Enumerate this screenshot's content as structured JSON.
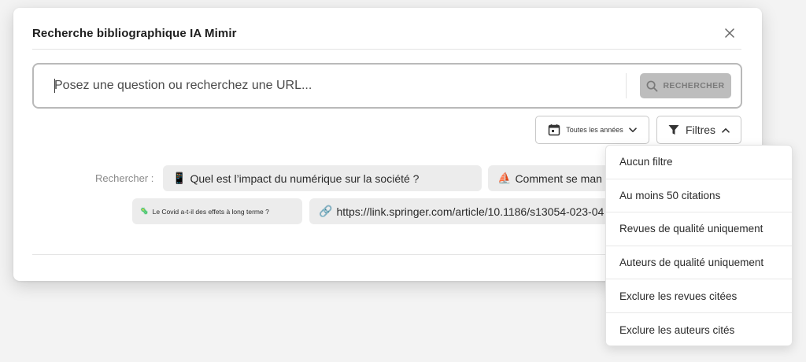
{
  "modal": {
    "title": "Recherche bibliographique IA Mimir"
  },
  "search": {
    "placeholder": "Posez une question ou recherchez une URL...",
    "button_label": "RECHERCHER"
  },
  "filters_bar": {
    "years_label": "Toutes les années",
    "filters_label": "Filtres"
  },
  "suggestions": {
    "label": "Rechercher :",
    "chips": [
      {
        "icon": "📱",
        "text": "Quel est l’impact du numérique sur la société ?"
      },
      {
        "icon": "⛵",
        "text": "Comment se man"
      },
      {
        "icon": "🦠",
        "text": "Le Covid a-t-il des effets à long terme ?"
      },
      {
        "icon": "🔗",
        "text": "https://link.springer.com/article/10.1186/s13054-023-04"
      }
    ]
  },
  "filters_menu": {
    "items": [
      "Aucun filtre",
      "Au moins 50 citations",
      "Revues de qualité uniquement",
      "Auteurs de qualité uniquement",
      "Exclure les revues citées",
      "Exclure les auteurs cités"
    ]
  },
  "colors": {
    "search_button_bg": "#bdbdbd",
    "chip_bg": "#ececec",
    "page_bg": "#f3f3f3"
  }
}
